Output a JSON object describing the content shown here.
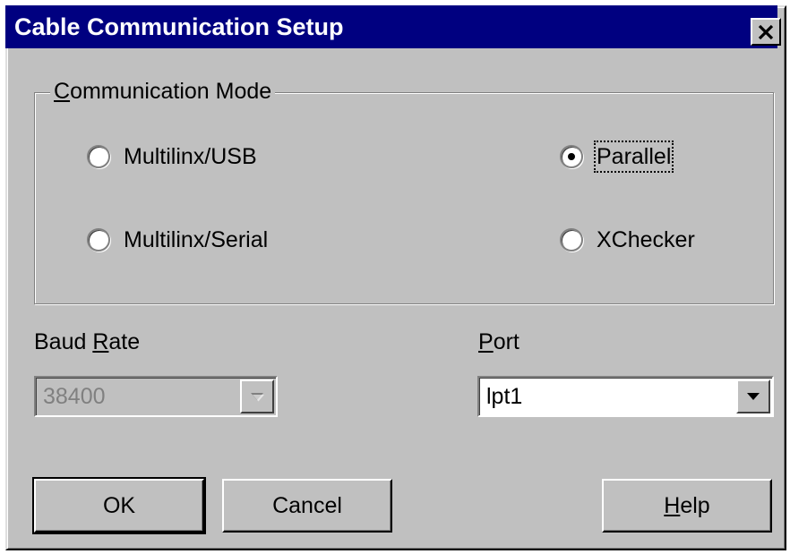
{
  "window": {
    "title": "Cable Communication Setup"
  },
  "communication_mode": {
    "legend_mnemonic": "C",
    "legend_rest": "ommunication Mode",
    "options": [
      {
        "label": "Multilinx/USB",
        "selected": false
      },
      {
        "label": "Parallel",
        "selected": true
      },
      {
        "label": "Multilinx/Serial",
        "selected": false
      },
      {
        "label": "XChecker",
        "selected": false
      }
    ]
  },
  "baud_rate": {
    "label_pre": "Baud ",
    "label_mnemonic": "R",
    "label_post": "ate",
    "value": "38400",
    "enabled": false
  },
  "port": {
    "label_mnemonic": "P",
    "label_post": "ort",
    "value": "lpt1",
    "enabled": true
  },
  "buttons": {
    "ok": "OK",
    "cancel": "Cancel",
    "help_mnemonic": "H",
    "help_rest": "elp"
  },
  "icons": {
    "close": "close-icon",
    "dropdown": "chevron-down-icon"
  },
  "colors": {
    "titlebar": "#000080",
    "face": "#c0c0c0",
    "disabled_text": "#808080"
  }
}
